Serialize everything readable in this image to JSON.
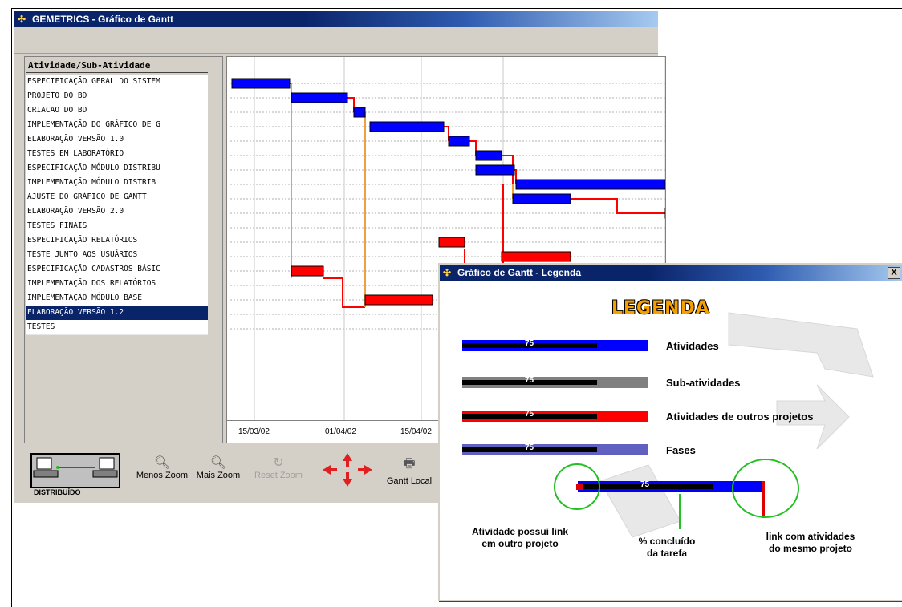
{
  "main_window": {
    "title": "GEMETRICS - Gráfico de Gantt",
    "tree_header": "Atividade/Sub-Atividade",
    "tree_rows": [
      "ESPECIFICAÇÃO GERAL DO SISTEM",
      "PROJETO DO BD",
      "CRIACAO DO BD",
      "IMPLEMENTAÇÃO DO GRÁFICO DE G",
      "ELABORAÇÃO VERSÃO 1.0",
      "TESTES EM LABORATÓRIO",
      "ESPECIFICAÇÃO MÓDULO DISTRIBU",
      "IMPLEMENTAÇÃO MÓDULO DISTRIB",
      "AJUSTE DO GRÁFICO DE GANTT",
      "ELABORAÇÃO VERSÃO 2.0",
      "TESTES FINAIS",
      "ESPECIFICAÇÃO RELATÓRIOS",
      "TESTE JUNTO AOS USUÁRIOS",
      "ESPECIFICAÇÃO CADASTROS BÁSIC",
      "IMPLEMENTAÇÃO DOS RELATÓRIOS",
      "IMPLEMENTAÇÃO MÓDULO BASE",
      "ELABORAÇÃO VERSÃO 1.2",
      "TESTES"
    ],
    "selected_row_index": 16,
    "date_ticks": [
      "15/03/02",
      "01/04/02",
      "15/04/02"
    ],
    "toolbar": {
      "distribuido_label": "DISTRIBUÍDO",
      "menos_zoom": "Menos Zoom",
      "mais_zoom": "Mais Zoom",
      "reset_zoom": "Reset Zoom",
      "gantt_local": "Gantt Local"
    },
    "colors": {
      "activity": "#0000ff",
      "other_project": "#ff0000",
      "link": "#ff0000",
      "link_alt": "#f0a040",
      "selection": "#0a246a"
    }
  },
  "legend_window": {
    "title": "Gráfico de Gantt - Legenda",
    "close": "X",
    "heading": "LEGENDA",
    "items": [
      {
        "label": "Atividades",
        "percent": "75",
        "color": "#0000ff"
      },
      {
        "label": "Sub-atividades",
        "percent": "75",
        "color": "#808080"
      },
      {
        "label": "Atividades de outros projetos",
        "percent": "75",
        "color": "#ff0000"
      },
      {
        "label": "Fases",
        "percent": "75",
        "color": "#6060c0"
      }
    ],
    "example_percent": "75",
    "captions": {
      "link_other": "Atividade possui link\nem outro projeto",
      "percent_done": "% concluído\nda tarefa",
      "link_same": "link com atividades\ndo mesmo projeto"
    }
  }
}
